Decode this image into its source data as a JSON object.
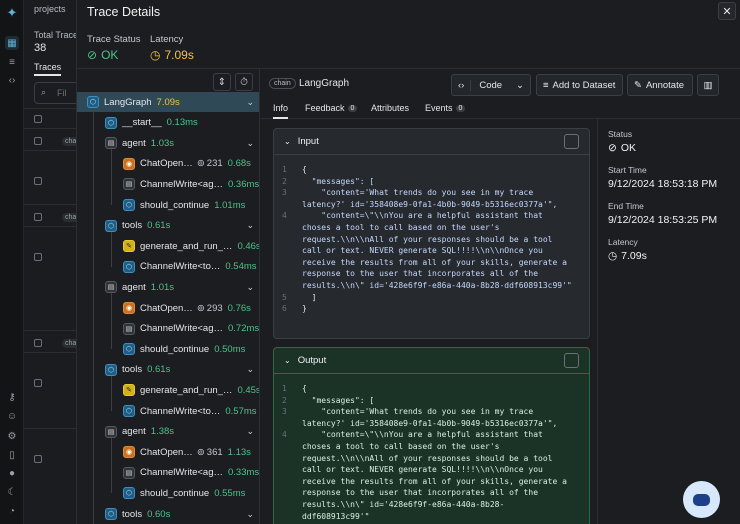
{
  "background": {
    "breadcrumb": "projects",
    "total_label": "Total Traces",
    "total_value": "38",
    "tab": "Traces",
    "search_placeholder": "Fil",
    "row_chip": "chain"
  },
  "drawer": {
    "title": "Trace Details",
    "close_glyph": "✕",
    "trace_status_label": "Trace Status",
    "trace_status_value": "OK",
    "latency_label": "Latency",
    "latency_value": "7.09s"
  },
  "tree": [
    {
      "name": "LangGraph",
      "latency": "7.09s",
      "icon": "blue",
      "glyph": "⬡",
      "indent": 0,
      "selected": true,
      "chevron": true,
      "lat_color": "yellow"
    },
    {
      "name": "__start__",
      "latency": "0.13ms",
      "icon": "blue",
      "glyph": "⬡",
      "indent": 1
    },
    {
      "name": "agent",
      "latency": "1.03s",
      "icon": "gray",
      "glyph": "▤",
      "indent": 1,
      "chevron": true
    },
    {
      "name": "ChatOpen…",
      "tokens": "231",
      "latency": "0.68s",
      "icon": "orange",
      "glyph": "◉",
      "indent": 2
    },
    {
      "name": "ChannelWrite<ag…",
      "latency": "0.36ms",
      "icon": "gray",
      "glyph": "▤",
      "indent": 2
    },
    {
      "name": "should_continue",
      "latency": "1.01ms",
      "icon": "blue",
      "glyph": "⬡",
      "indent": 2
    },
    {
      "name": "tools",
      "latency": "0.61s",
      "icon": "blue",
      "glyph": "⬡",
      "indent": 1,
      "chevron": true
    },
    {
      "name": "generate_and_run_…",
      "latency": "0.46s",
      "icon": "yellow",
      "glyph": "✎",
      "indent": 2
    },
    {
      "name": "ChannelWrite<to…",
      "latency": "0.54ms",
      "icon": "blue",
      "glyph": "⬡",
      "indent": 2
    },
    {
      "name": "agent",
      "latency": "1.01s",
      "icon": "gray",
      "glyph": "▤",
      "indent": 1,
      "chevron": true
    },
    {
      "name": "ChatOpen…",
      "tokens": "293",
      "latency": "0.76s",
      "icon": "orange",
      "glyph": "◉",
      "indent": 2
    },
    {
      "name": "ChannelWrite<ag…",
      "latency": "0.72ms",
      "icon": "gray",
      "glyph": "▤",
      "indent": 2
    },
    {
      "name": "should_continue",
      "latency": "0.50ms",
      "icon": "blue",
      "glyph": "⬡",
      "indent": 2
    },
    {
      "name": "tools",
      "latency": "0.61s",
      "icon": "blue",
      "glyph": "⬡",
      "indent": 1,
      "chevron": true
    },
    {
      "name": "generate_and_run_…",
      "latency": "0.45s",
      "icon": "yellow",
      "glyph": "✎",
      "indent": 2
    },
    {
      "name": "ChannelWrite<to…",
      "latency": "0.57ms",
      "icon": "blue",
      "glyph": "⬡",
      "indent": 2
    },
    {
      "name": "agent",
      "latency": "1.38s",
      "icon": "gray",
      "glyph": "▤",
      "indent": 1,
      "chevron": true
    },
    {
      "name": "ChatOpen…",
      "tokens": "361",
      "latency": "1.13s",
      "icon": "orange",
      "glyph": "◉",
      "indent": 2
    },
    {
      "name": "ChannelWrite<ag…",
      "latency": "0.33ms",
      "icon": "gray",
      "glyph": "▤",
      "indent": 2
    },
    {
      "name": "should_continue",
      "latency": "0.55ms",
      "icon": "blue",
      "glyph": "⬡",
      "indent": 2
    },
    {
      "name": "tools",
      "latency": "0.60s",
      "icon": "blue",
      "glyph": "⬡",
      "indent": 1,
      "chevron": true
    }
  ],
  "main": {
    "chip": "chain",
    "title": "LangGraph",
    "code_button": "Code",
    "add_dataset_button": "Add to Dataset",
    "annotate_button": "Annotate",
    "tabs": [
      {
        "label": "Info",
        "active": true
      },
      {
        "label": "Feedback",
        "badge": "0"
      },
      {
        "label": "Attributes"
      },
      {
        "label": "Events",
        "badge": "0"
      }
    ],
    "input_title": "Input",
    "output_title": "Output",
    "input_lines": [
      {
        "n": "1",
        "t": "{"
      },
      {
        "n": "2",
        "t": "  \"messages\": ["
      },
      {
        "n": "3",
        "t": "    \"content='What trends do you see in my trace"
      },
      {
        "n": "",
        "t": "latency?' id='358408e9-0fa1-4b0b-9049-b5316ec0377a'\","
      },
      {
        "n": "4",
        "t": "    \"content=\\\"\\\\nYou are a helpful assistant that"
      },
      {
        "n": "",
        "t": "choses a tool to call based on the user's"
      },
      {
        "n": "",
        "t": "request.\\\\n\\\\nAll of your responses should be a tool"
      },
      {
        "n": "",
        "t": "call or text. NEVER generate SQL!!!!\\\\n\\\\nOnce you"
      },
      {
        "n": "",
        "t": "receive the results from all of your skills, generate a"
      },
      {
        "n": "",
        "t": "response to the user that incorporates all of the"
      },
      {
        "n": "",
        "t": "results.\\\\n\\\" id='428e6f9f-e86a-440a-8b28-ddf608913c99'\""
      },
      {
        "n": "5",
        "t": "  ]"
      },
      {
        "n": "6",
        "t": "}"
      }
    ],
    "output_lines": [
      {
        "n": "1",
        "t": "{"
      },
      {
        "n": "2",
        "t": "  \"messages\": ["
      },
      {
        "n": "3",
        "t": "    \"content='What trends do you see in my trace"
      },
      {
        "n": "",
        "t": "latency?' id='358408e9-0fa1-4b0b-9049-b5316ec0377a'\","
      },
      {
        "n": "4",
        "t": "    \"content=\\\"\\\\nYou are a helpful assistant that"
      },
      {
        "n": "",
        "t": "choses a tool to call based on the user's"
      },
      {
        "n": "",
        "t": "request.\\\\n\\\\nAll of your responses should be a tool"
      },
      {
        "n": "",
        "t": "call or text. NEVER generate SQL!!!!\\\\n\\\\nOnce you"
      },
      {
        "n": "",
        "t": "receive the results from all of your skills, generate a"
      },
      {
        "n": "",
        "t": "response to the user that incorporates all of the"
      },
      {
        "n": "",
        "t": "results.\\\\n\\\" id='428e6f9f-e86a-440a-8b28-"
      },
      {
        "n": "",
        "t": "ddf608913c99'\""
      }
    ]
  },
  "side": {
    "status_label": "Status",
    "status_value": "OK",
    "start_label": "Start Time",
    "start_value": "9/12/2024 18:53:18 PM",
    "end_label": "End Time",
    "end_value": "9/12/2024 18:53:25 PM",
    "latency_label": "Latency",
    "latency_value": "7.09s"
  },
  "colors": {
    "ok": "#4cc38a",
    "latency": "#f5c242",
    "selected": "#2f4957",
    "output_bg": "#1a3326"
  }
}
